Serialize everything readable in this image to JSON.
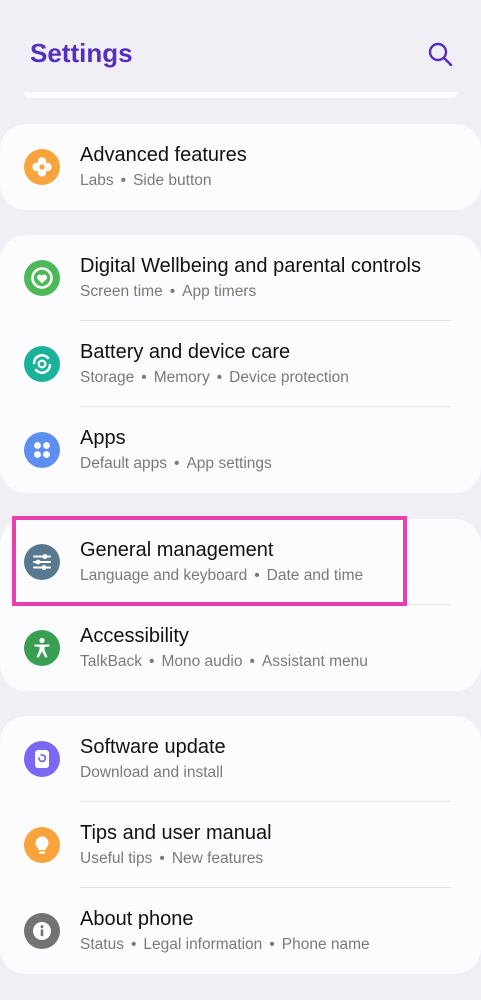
{
  "header": {
    "title": "Settings",
    "search_icon": "search-icon"
  },
  "colors": {
    "title": "#5530c0",
    "highlight": "#ea3fae",
    "background": "#f1eff6"
  },
  "groups": [
    {
      "items": [
        {
          "title": "Advanced features",
          "sub": [
            "Labs",
            "Side button"
          ],
          "icon": "advanced-features-icon",
          "icon_color": "#f8a33b"
        }
      ]
    },
    {
      "items": [
        {
          "title": "Digital Wellbeing and parental controls",
          "sub": [
            "Screen time",
            "App timers"
          ],
          "icon": "digital-wellbeing-icon",
          "icon_color": "#4cb85a"
        },
        {
          "title": "Battery and device care",
          "sub": [
            "Storage",
            "Memory",
            "Device protection"
          ],
          "icon": "device-care-icon",
          "icon_color": "#18b39a"
        },
        {
          "title": "Apps",
          "sub": [
            "Default apps",
            "App settings"
          ],
          "icon": "apps-icon",
          "icon_color": "#5e8ff0"
        }
      ]
    },
    {
      "items": [
        {
          "title": "General management",
          "sub": [
            "Language and keyboard",
            "Date and time"
          ],
          "icon": "general-management-icon",
          "icon_color": "#5a7890"
        },
        {
          "title": "Accessibility",
          "sub": [
            "TalkBack",
            "Mono audio",
            "Assistant menu"
          ],
          "icon": "accessibility-icon",
          "icon_color": "#3a9e52"
        }
      ]
    },
    {
      "items": [
        {
          "title": "Software update",
          "sub": [
            "Download and install"
          ],
          "icon": "software-update-icon",
          "icon_color": "#7a68f2"
        },
        {
          "title": "Tips and user manual",
          "sub": [
            "Useful tips",
            "New features"
          ],
          "icon": "tips-icon",
          "icon_color": "#f8a33b"
        },
        {
          "title": "About phone",
          "sub": [
            "Status",
            "Legal information",
            "Phone name"
          ],
          "icon": "info-icon",
          "icon_color": "#737373"
        }
      ]
    }
  ]
}
